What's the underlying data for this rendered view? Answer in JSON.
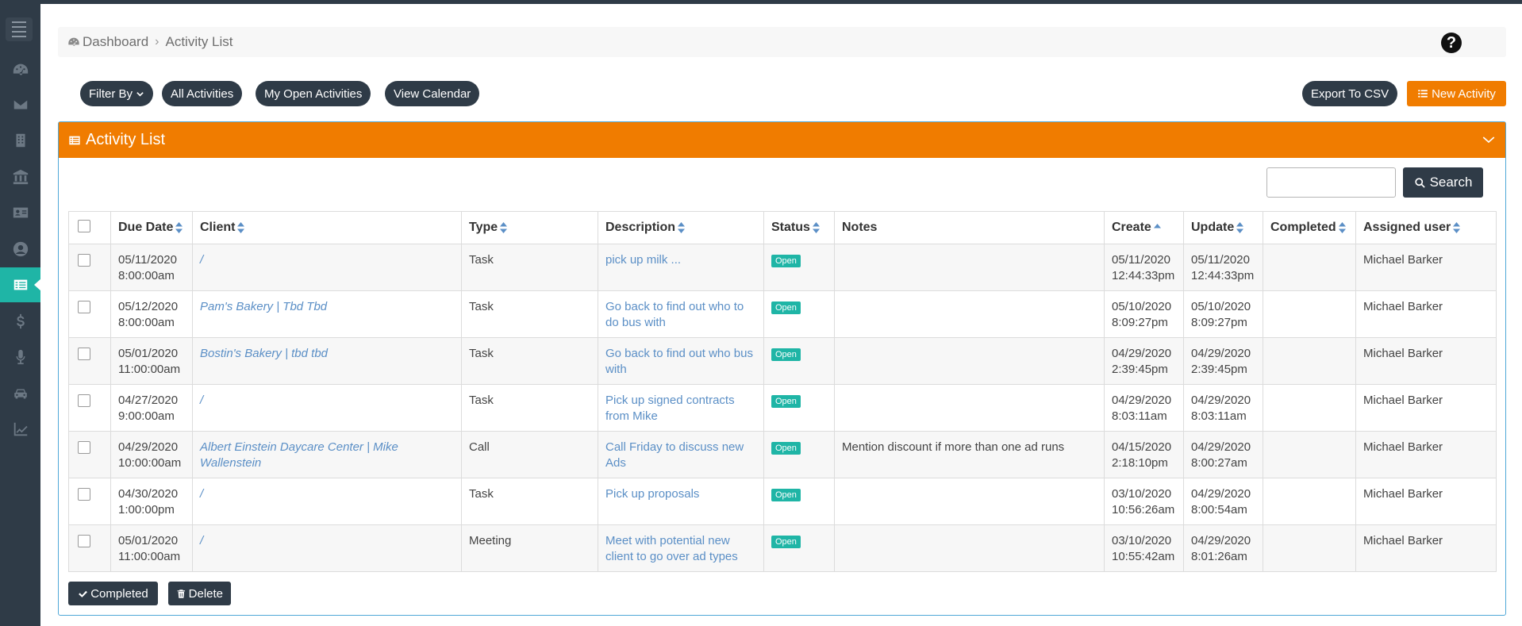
{
  "breadcrumb": {
    "home": "Dashboard",
    "current": "Activity List"
  },
  "toolbar": {
    "filter_label": "Filter By",
    "all_label": "All Activities",
    "open_label": "My Open Activities",
    "calendar_label": "View Calendar",
    "export_label": "Export To CSV",
    "new_label": "New Activity"
  },
  "panel": {
    "title": "Activity List",
    "search_value": "",
    "search_label": "Search"
  },
  "table": {
    "headers": {
      "due": "Due Date",
      "client": "Client",
      "type": "Type",
      "description": "Description",
      "status": "Status",
      "notes": "Notes",
      "create": "Create",
      "update": "Update",
      "completed": "Completed",
      "assigned": "Assigned user"
    },
    "rows": [
      {
        "due1": "05/11/2020",
        "due2": "8:00:00am",
        "client": "/",
        "type": "Task",
        "description": "pick up milk ...",
        "status": "Open",
        "notes": "",
        "create1": "05/11/2020",
        "create2": "12:44:33pm",
        "update1": "05/11/2020",
        "update2": "12:44:33pm",
        "completed": "",
        "assigned": "Michael Barker"
      },
      {
        "due1": "05/12/2020",
        "due2": "8:00:00am",
        "client": "Pam's Bakery | Tbd Tbd",
        "type": "Task",
        "description": "Go back to find out who to do bus with",
        "status": "Open",
        "notes": "",
        "create1": "05/10/2020",
        "create2": "8:09:27pm",
        "update1": "05/10/2020",
        "update2": "8:09:27pm",
        "completed": "",
        "assigned": "Michael Barker"
      },
      {
        "due1": "05/01/2020",
        "due2": "11:00:00am",
        "client": "Bostin's Bakery | tbd tbd",
        "type": "Task",
        "description": "Go back to find out who bus with",
        "status": "Open",
        "notes": "",
        "create1": "04/29/2020",
        "create2": "2:39:45pm",
        "update1": "04/29/2020",
        "update2": "2:39:45pm",
        "completed": "",
        "assigned": "Michael Barker"
      },
      {
        "due1": "04/27/2020",
        "due2": "9:00:00am",
        "client": "/",
        "type": "Task",
        "description": "Pick up signed contracts from Mike",
        "status": "Open",
        "notes": "",
        "create1": "04/29/2020",
        "create2": "8:03:11am",
        "update1": "04/29/2020",
        "update2": "8:03:11am",
        "completed": "",
        "assigned": "Michael Barker"
      },
      {
        "due1": "04/29/2020",
        "due2": "10:00:00am",
        "client": "Albert Einstein Daycare Center | Mike Wallenstein",
        "type": "Call",
        "description": "Call Friday to discuss new Ads",
        "status": "Open",
        "notes": "Mention discount if more than one ad runs",
        "create1": "04/15/2020",
        "create2": "2:18:10pm",
        "update1": "04/29/2020",
        "update2": "8:00:27am",
        "completed": "",
        "assigned": "Michael Barker"
      },
      {
        "due1": "04/30/2020",
        "due2": "1:00:00pm",
        "client": "/",
        "type": "Task",
        "description": "Pick up proposals",
        "status": "Open",
        "notes": "",
        "create1": "03/10/2020",
        "create2": "10:56:26am",
        "update1": "04/29/2020",
        "update2": "8:00:54am",
        "completed": "",
        "assigned": "Michael Barker"
      },
      {
        "due1": "05/01/2020",
        "due2": "11:00:00am",
        "client": "/",
        "type": "Meeting",
        "description": "Meet with potential new client to go over ad types",
        "status": "Open",
        "notes": "",
        "create1": "03/10/2020",
        "create2": "10:55:42am",
        "update1": "04/29/2020",
        "update2": "8:01:26am",
        "completed": "",
        "assigned": "Michael Barker"
      }
    ]
  },
  "actions": {
    "completed_label": "Completed",
    "delete_label": "Delete"
  },
  "colors": {
    "sidebar": "#2f3b47",
    "accent": "#f07c00",
    "teal": "#1fb5a6",
    "link": "#5b8fc6"
  },
  "icons": {
    "sidebar": [
      "menu-icon",
      "dashboard-icon",
      "envelope-icon",
      "building-icon",
      "bank-icon",
      "id-card-icon",
      "user-circle-icon",
      "list-icon",
      "dollar-icon",
      "microphone-icon",
      "car-icon",
      "line-chart-icon"
    ]
  }
}
